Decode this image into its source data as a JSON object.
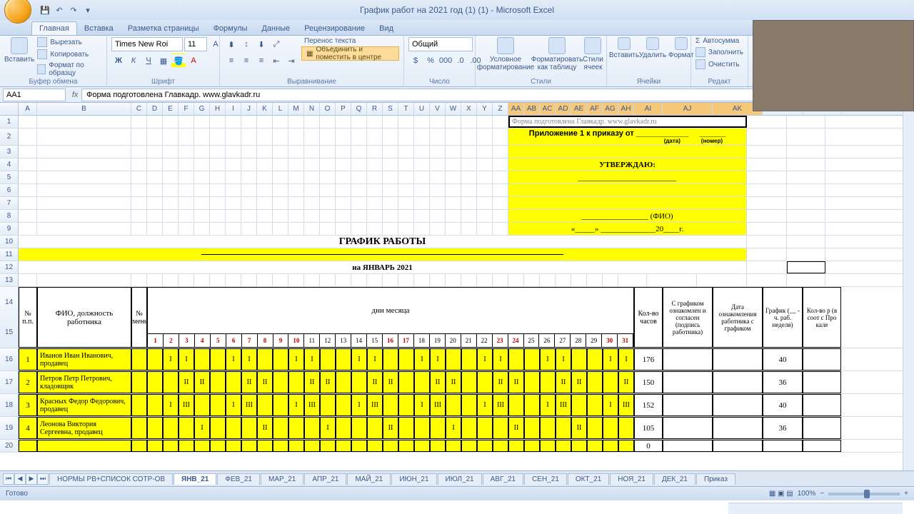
{
  "window": {
    "title": "График работ на 2021 год (1) (1) - Microsoft Excel"
  },
  "qat": {
    "save": "save-icon",
    "undo": "undo-icon",
    "redo": "redo-icon"
  },
  "tabs": [
    "Главная",
    "Вставка",
    "Разметка страницы",
    "Формулы",
    "Данные",
    "Рецензирование",
    "Вид"
  ],
  "ribbon": {
    "clipboard": {
      "label": "Буфер обмена",
      "paste": "Вставить",
      "cut": "Вырезать",
      "copy": "Копировать",
      "fmt": "Формат по образцу"
    },
    "font": {
      "label": "Шрифт",
      "name": "Times New Roi",
      "size": "11"
    },
    "align": {
      "label": "Выравнивание",
      "wrap": "Перенос текста",
      "merge": "Объединить и поместить в центре"
    },
    "number": {
      "label": "Число",
      "format": "Общий"
    },
    "styles": {
      "label": "Стили",
      "cond": "Условное форматирование",
      "table": "Форматировать как таблицу",
      "cell": "Стили ячеек"
    },
    "cells": {
      "label": "Ячейки",
      "insert": "Вставить",
      "delete": "Удалить",
      "format": "Формат"
    },
    "editing": {
      "label": "Редакт",
      "sum": "Автосумма",
      "fill": "Заполнить",
      "clear": "Очистить"
    }
  },
  "namebox": "AA1",
  "formula": "Форма подготовлена Главкадр. www.glavkadr.ru",
  "columns": {
    "A": 26,
    "B": 132,
    "days": [
      "C",
      "D",
      "E",
      "F",
      "G",
      "H",
      "I",
      "J",
      "K",
      "L",
      "M",
      "N",
      "O",
      "P",
      "Q",
      "R",
      "S",
      "T",
      "U",
      "V",
      "W",
      "X",
      "Y",
      "Z",
      "AA",
      "AB",
      "AC",
      "AD",
      "AE",
      "AF",
      "AG",
      "AH"
    ],
    "AI": 40,
    "AJ": 70,
    "AK": 70,
    "AL": 56,
    "AM": 54
  },
  "doc": {
    "form_src": "Форма подготовлена Главкадр. www.glavkadr.ru",
    "app_line": "Приложение 1 к приказу от",
    "date_lbl": "(дата)",
    "num_lbl": "(номер)",
    "approve": "УТВЕРЖДАЮ:",
    "fio": "_________________ (ФИО)",
    "dateline": "«_____» ______________20____г.",
    "title": "ГРАФИК РАБОТЫ",
    "month": "на ЯНВАРЬ 2021",
    "hdr": {
      "num": "№ п.п.",
      "name": "ФИО, должность работника",
      "shift": "№ смены",
      "days": "дни  месяца",
      "hours": "Кол-во часов",
      "sign": "С графиком ознакомлен и согласен (подпись работника)",
      "signdate": "Дата ознакомления работника с графиком",
      "schedule": "График (__ - ч. раб. неделя)",
      "norm": "Кол-во р (в соот с Про кале"
    },
    "daynums": [
      1,
      2,
      3,
      4,
      5,
      6,
      7,
      8,
      9,
      10,
      11,
      12,
      13,
      14,
      15,
      16,
      17,
      18,
      19,
      20,
      21,
      22,
      23,
      24,
      25,
      26,
      27,
      28,
      29,
      30,
      31
    ],
    "weekends": [
      1,
      2,
      3,
      4,
      5,
      6,
      7,
      8,
      9,
      10,
      16,
      17,
      23,
      24,
      30,
      31
    ],
    "rows": [
      {
        "n": 1,
        "name": "Иванов Иван Иванович, продавец",
        "sh": [
          null,
          "I",
          "I",
          null,
          null,
          "I",
          "I",
          null,
          null,
          "I",
          "I",
          null,
          null,
          "I",
          "I",
          null,
          null,
          "I",
          "I",
          null,
          null,
          "I",
          "I",
          null,
          null,
          "I",
          "I",
          null,
          null,
          "I",
          "I"
        ],
        "hours": 176,
        "wk": 40
      },
      {
        "n": 2,
        "name": "Петров Петр Петрович, кладовщик",
        "sh": [
          null,
          null,
          "II",
          "II",
          null,
          null,
          "II",
          "II",
          null,
          null,
          "II",
          "II",
          null,
          null,
          "II",
          "II",
          null,
          null,
          "II",
          "II",
          null,
          null,
          "II",
          "II",
          null,
          null,
          "II",
          "II",
          null,
          null,
          "II"
        ],
        "hours": 150,
        "wk": 36
      },
      {
        "n": 3,
        "name": "Красных Федор Федорович, продавец",
        "sh": [
          null,
          "I",
          "III",
          null,
          null,
          "I",
          "III",
          null,
          null,
          "I",
          "III",
          null,
          null,
          "I",
          "III",
          null,
          null,
          "I",
          "III",
          null,
          null,
          "I",
          "III",
          null,
          null,
          "I",
          "III",
          null,
          null,
          "I",
          "III"
        ],
        "hours": 152,
        "wk": 40
      },
      {
        "n": 4,
        "name": "Леонова Виктория Сергеевна, продавец",
        "sh": [
          null,
          null,
          null,
          "I",
          null,
          null,
          null,
          "II",
          null,
          null,
          null,
          "I",
          null,
          null,
          null,
          "II",
          null,
          null,
          null,
          "I",
          null,
          null,
          null,
          "II",
          null,
          null,
          null,
          "II",
          null,
          null,
          null
        ],
        "hours": 105,
        "wk": 36
      }
    ],
    "row20_hours": 0
  },
  "sheets": [
    "НОРМЫ РВ+СПИСОК СОТР-ОВ",
    "ЯНВ_21",
    "ФЕВ_21",
    "МАР_21",
    "АПР_21",
    "МАЙ_21",
    "ИЮН_21",
    "ИЮЛ_21",
    "АВГ_21",
    "СЕН_21",
    "ОКТ_21",
    "НОЯ_21",
    "ДЕК_21",
    "Приказ"
  ],
  "active_sheet": 1,
  "status": {
    "ready": "Готово",
    "zoom": "100%"
  }
}
